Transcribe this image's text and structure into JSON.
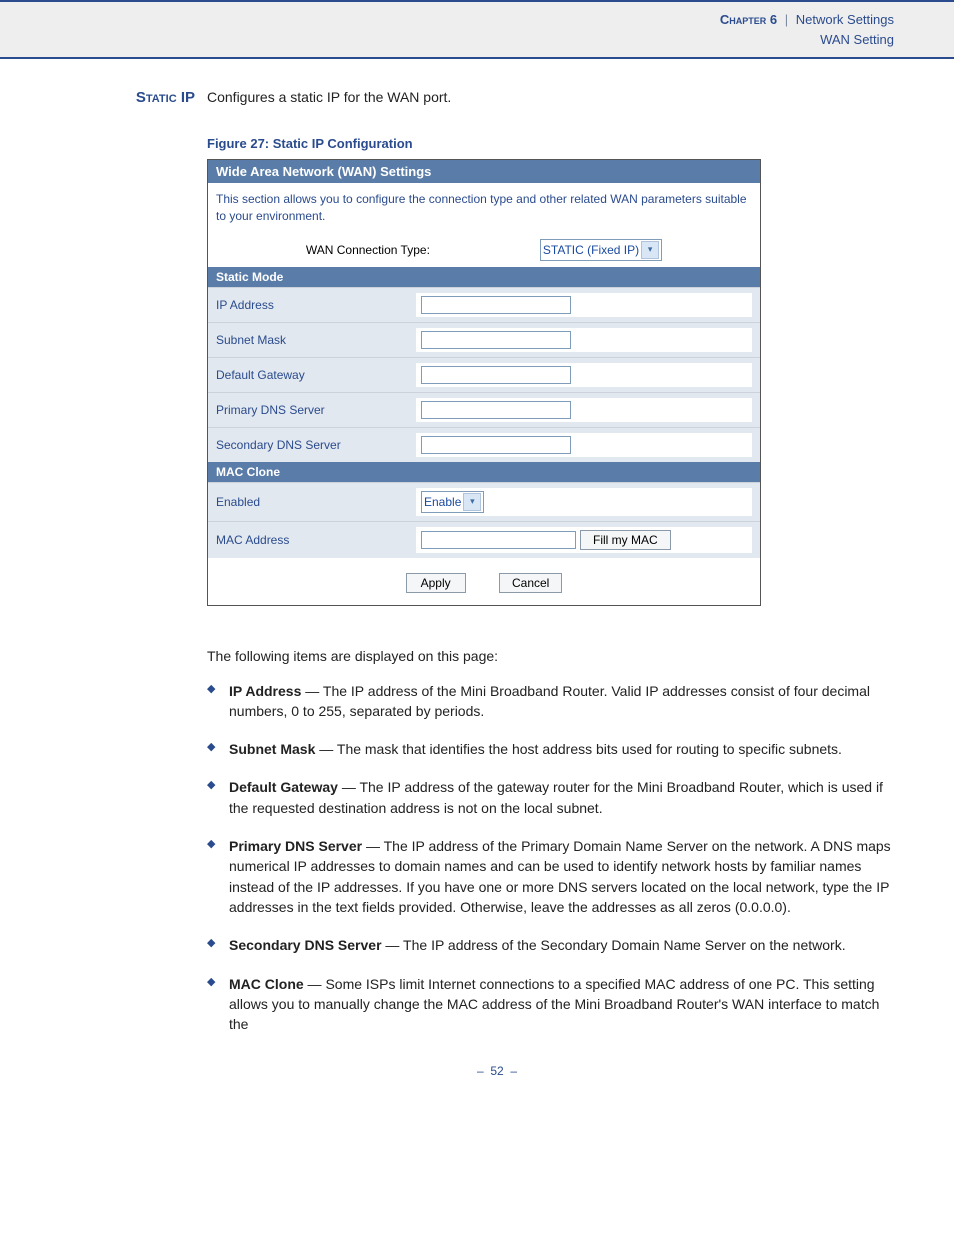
{
  "header": {
    "chapter": "Chapter 6",
    "section": "Network Settings",
    "subsection": "WAN Setting"
  },
  "section_heading": "Static IP",
  "section_intro": "Configures a static IP for the WAN port.",
  "figure_caption": "Figure 27:  Static IP Configuration",
  "ui": {
    "title": "Wide Area Network (WAN) Settings",
    "description": "This section allows you to configure the connection type and other related WAN parameters suitable to your environment.",
    "conn_label": "WAN Connection Type:",
    "conn_value": "STATIC (Fixed IP)",
    "static_mode_header": "Static Mode",
    "fields": {
      "ip": "IP Address",
      "subnet": "Subnet Mask",
      "gateway": "Default Gateway",
      "dns1": "Primary DNS Server",
      "dns2": "Secondary DNS Server"
    },
    "mac_clone_header": "MAC Clone",
    "mac": {
      "enabled_label": "Enabled",
      "enabled_value": "Enable",
      "addr_label": "MAC Address",
      "fill_btn": "Fill my MAC"
    },
    "apply_btn": "Apply",
    "cancel_btn": "Cancel"
  },
  "body": {
    "intro": "The following items are displayed on this page:",
    "items": [
      {
        "term": "IP Address",
        "desc": " — The IP address of the Mini Broadband Router. Valid IP addresses consist of four decimal numbers, 0 to 255, separated by periods."
      },
      {
        "term": "Subnet Mask",
        "desc": " — The mask that identifies the host address bits used for routing to specific subnets."
      },
      {
        "term": "Default Gateway",
        "desc": " — The IP address of the gateway router for the Mini Broadband Router, which is used if the requested destination address is not on the local subnet."
      },
      {
        "term": "Primary DNS Server",
        "desc": " — The IP address of the Primary Domain Name Server on the network. A DNS maps numerical IP addresses to domain names and can be used to identify network hosts by familiar names instead of the IP addresses. If you have one or more DNS servers located on the local network, type the IP addresses in the text fields provided. Otherwise, leave the addresses as all zeros (0.0.0.0)."
      },
      {
        "term": "Secondary DNS Server",
        "desc": " — The IP address of the Secondary Domain Name Server on the network."
      },
      {
        "term": "MAC Clone",
        "desc": " — Some ISPs limit Internet connections to a specified MAC address of one PC. This setting allows you to manually change the MAC address of the Mini Broadband Router's WAN interface to match the"
      }
    ]
  },
  "page_number": "52"
}
